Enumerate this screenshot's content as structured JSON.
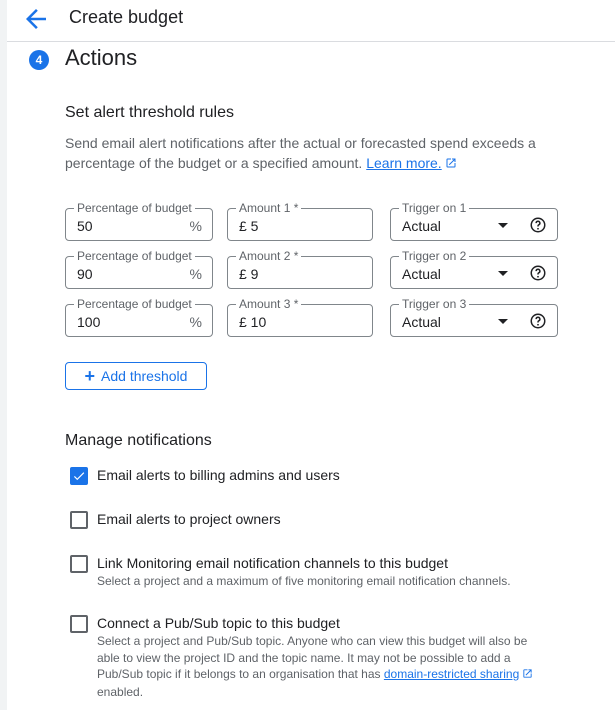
{
  "header": {
    "title": "Create budget"
  },
  "step": {
    "number": "4",
    "title": "Actions"
  },
  "thresholds": {
    "heading": "Set alert threshold rules",
    "description": "Send email alert notifications after the actual or forecasted spend exceeds a percentage of the budget or a specified amount.",
    "learn_more": "Learn more.",
    "rows": [
      {
        "pct_label": "Percentage of budget",
        "pct_value": "50",
        "pct_suffix": "%",
        "amount_label": "Amount 1 *",
        "amount_value": "£ 5",
        "trigger_label": "Trigger on 1",
        "trigger_value": "Actual"
      },
      {
        "pct_label": "Percentage of budget",
        "pct_value": "90",
        "pct_suffix": "%",
        "amount_label": "Amount 2 *",
        "amount_value": "£ 9",
        "trigger_label": "Trigger on 2",
        "trigger_value": "Actual"
      },
      {
        "pct_label": "Percentage of budget",
        "pct_value": "100",
        "pct_suffix": "%",
        "amount_label": "Amount 3 *",
        "amount_value": "£ 10",
        "trigger_label": "Trigger on 3",
        "trigger_value": "Actual"
      }
    ],
    "add_button": "Add threshold"
  },
  "notifications": {
    "heading": "Manage notifications",
    "items": [
      {
        "label": "Email alerts to billing admins and users",
        "checked": true
      },
      {
        "label": "Email alerts to project owners",
        "checked": false
      },
      {
        "label": "Link Monitoring email notification channels to this budget",
        "checked": false,
        "sub": "Select a project and a maximum of five monitoring email notification channels."
      },
      {
        "label": "Connect a Pub/Sub topic to this budget",
        "checked": false,
        "sub_before": "Select a project and Pub/Sub topic. Anyone who can view this budget will also be able to view the project ID and the topic name. It may not be possible to add a Pub/Sub topic if it belongs to an organisation that has",
        "sub_link": "domain-restricted sharing",
        "sub_after": "enabled."
      }
    ]
  },
  "colors": {
    "accent": "#1a73e8",
    "text": "#202124",
    "muted": "#5f6368",
    "border": "#80868b"
  }
}
